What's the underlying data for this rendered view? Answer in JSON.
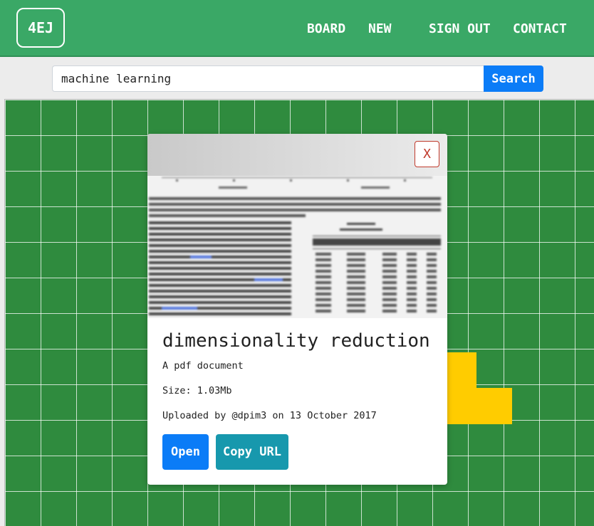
{
  "nav": {
    "logo": "4EJ",
    "links": [
      "BOARD",
      "NEW",
      "SIGN OUT",
      "CONTACT"
    ]
  },
  "search": {
    "value": "machine learning",
    "button_label": "Search"
  },
  "modal": {
    "close_label": "X",
    "title": "dimensionality reduction",
    "type_text": "A pdf document",
    "size_text": "Size: 1.03Mb",
    "uploaded_text": "Uploaded by @dpim3 on 13 October 2017",
    "open_label": "Open",
    "copy_label": "Copy URL"
  },
  "colors": {
    "nav_bg": "#3aa866",
    "board_bg": "#2f8b3e",
    "tile": "#ffcc00",
    "primary": "#0b7cf7",
    "info": "#1798ad",
    "danger": "#c0392b"
  }
}
